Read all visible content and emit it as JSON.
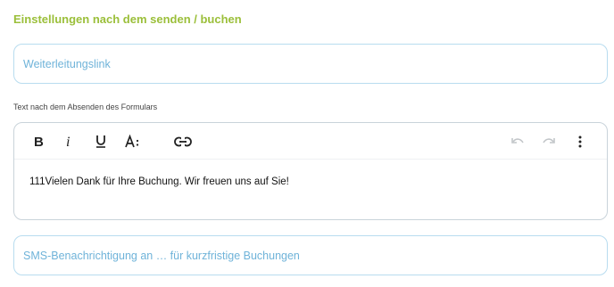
{
  "section": {
    "title": "Einstellungen nach dem senden / buchen"
  },
  "redirect_field": {
    "placeholder": "Weiterleitungslink"
  },
  "editor": {
    "label": "Text nach dem Absenden des Formulars",
    "content": "111Vielen Dank für Ihre Buchung. Wir freuen uns auf Sie!",
    "toolbar": {
      "bold_icon": "B",
      "italic_icon": "i",
      "underline_icon": "U",
      "font_size_icon": "A↕",
      "link_icon": "link-icon",
      "undo_icon": "undo-icon",
      "redo_icon": "redo-icon",
      "more_icon": "more-vertical-icon"
    }
  },
  "sms_field": {
    "placeholder": "SMS-Benachrichtigung an … für kurzfristige Buchungen"
  },
  "colors": {
    "section_title": "#9bbf3a",
    "field_border": "#b8dcef",
    "placeholder": "#6fb3d9",
    "disabled_icon": "#c2c6c9"
  }
}
